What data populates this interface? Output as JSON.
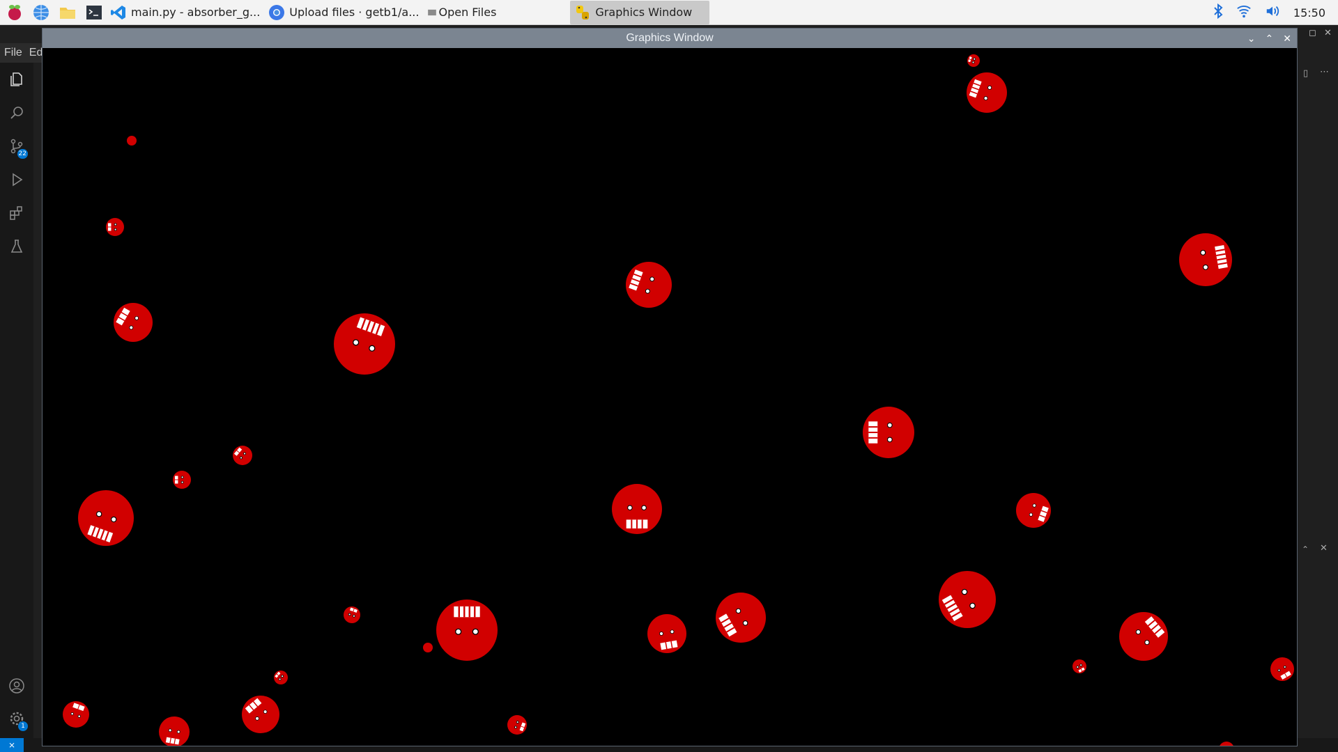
{
  "taskbar": {
    "tasks": [
      {
        "label": "main.py - absorber_g...",
        "icon": "vscode-icon"
      },
      {
        "label": "Upload files · getb1/a...",
        "icon": "chromium-icon"
      },
      {
        "label": "Open Files",
        "icon": "folder-small-icon"
      },
      {
        "label": "Graphics Window",
        "icon": "python-icon",
        "active": true
      }
    ],
    "clock": "15:50"
  },
  "vscode": {
    "menu": {
      "file": "File",
      "edit": "Ed"
    },
    "source_control_badge": "22",
    "settings_badge": "1"
  },
  "graphics_window": {
    "title": "Graphics Window"
  },
  "colors": {
    "blob": "#d10000",
    "teeth": "#ffffff",
    "canvas": "#000000",
    "titlebar": "#7b8591"
  }
}
